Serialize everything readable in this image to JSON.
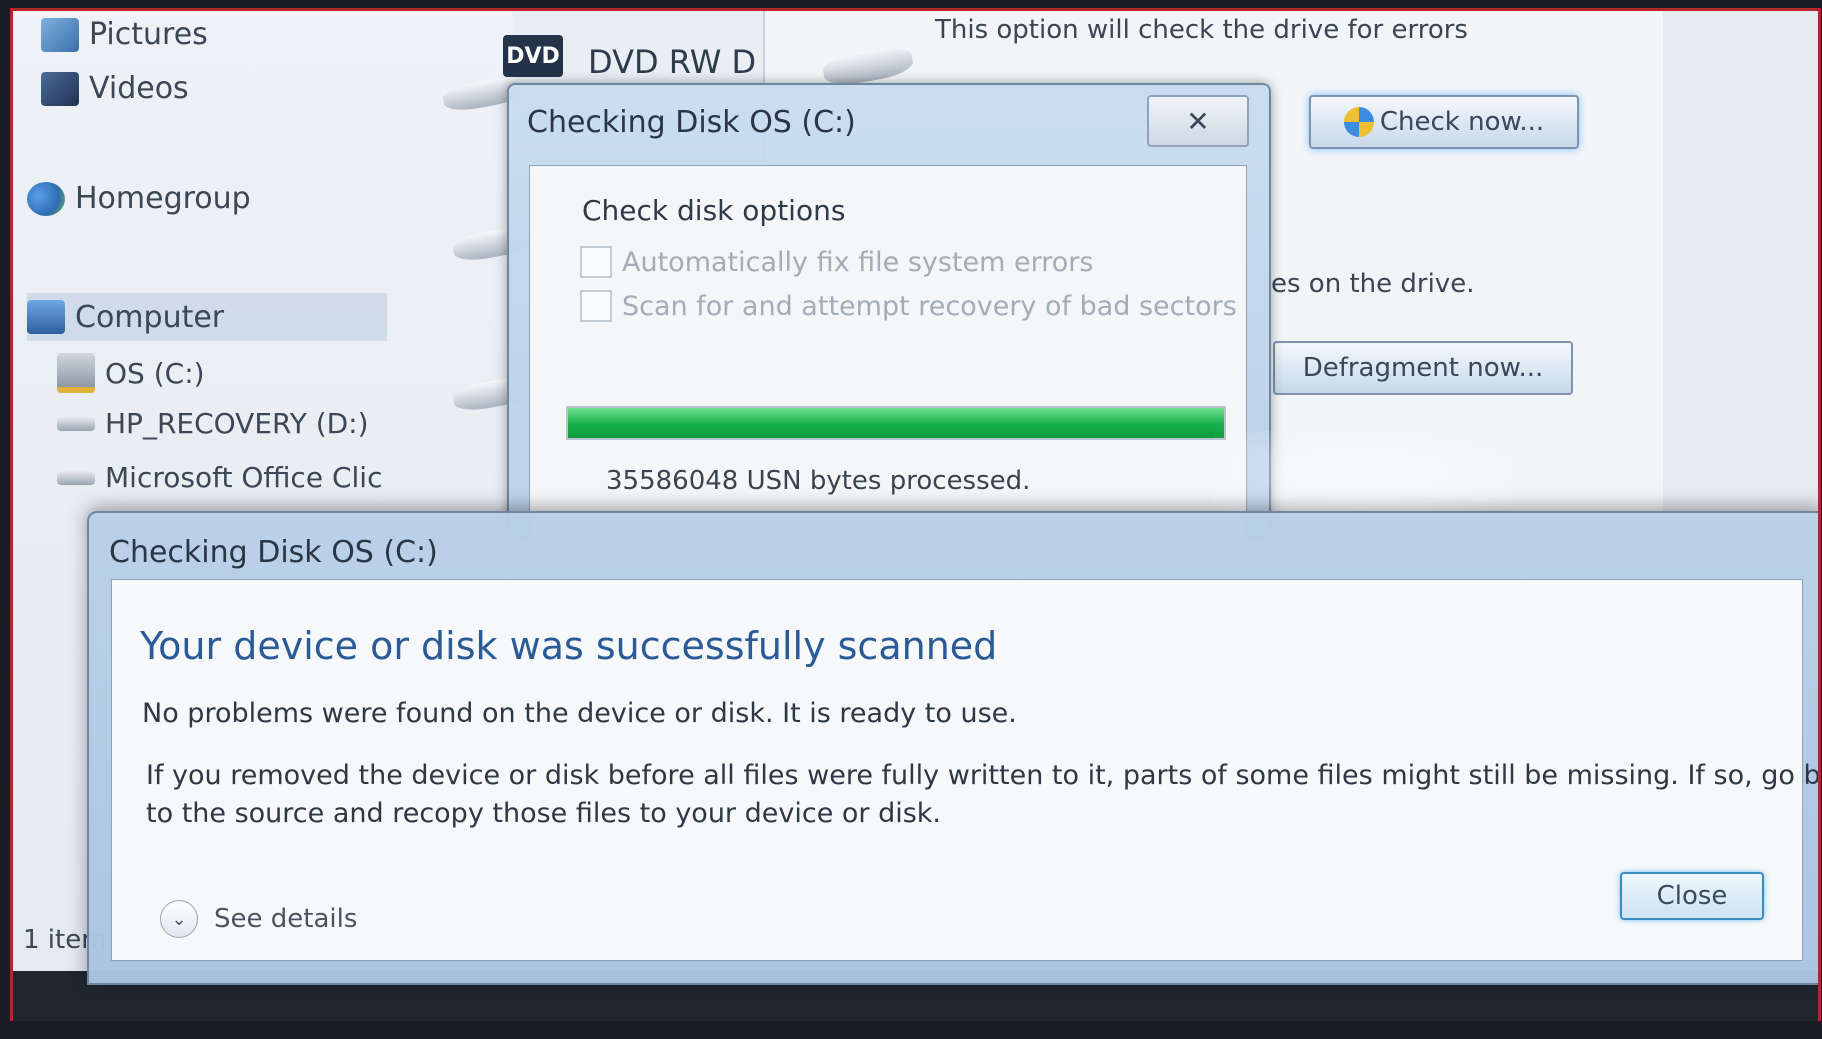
{
  "nav": {
    "items": [
      {
        "label": "Pictures",
        "icon": "pictures-icon"
      },
      {
        "label": "Videos",
        "icon": "videos-icon"
      },
      {
        "label": "Homegroup",
        "icon": "homegroup-icon"
      },
      {
        "label": "Computer",
        "icon": "computer-icon"
      },
      {
        "label": "OS (C:)",
        "icon": "hard-drive-icon"
      },
      {
        "label": "HP_RECOVERY (D:)",
        "icon": "drive-icon"
      },
      {
        "label": "Microsoft Office Clic",
        "icon": "drive-icon"
      }
    ]
  },
  "content": {
    "dvd_badge": "DVD",
    "dvd_label": "DVD RW D"
  },
  "properties": {
    "error_check_info": "This option will check the drive for errors",
    "check_now_button": "Check now...",
    "defrag_info": "es on the drive.",
    "defrag_button": "Defragment now..."
  },
  "status_bar": {
    "items_text": "1 item"
  },
  "progress_dialog": {
    "title": "Checking Disk OS (C:)",
    "close_glyph": "✕",
    "group_title": "Check disk options",
    "options": [
      {
        "label": "Automatically fix file system errors",
        "checked": false
      },
      {
        "label": "Scan for and attempt recovery of bad sectors",
        "checked": false
      }
    ],
    "progress_fraction": 1.0,
    "progress_color": "#17b04a",
    "status_text": "35586048 USN bytes processed."
  },
  "result_dialog": {
    "title": "Checking Disk OS (C:)",
    "heading": "Your device or disk was successfully scanned",
    "heading_color": "#2a5b97",
    "message1": "No problems were found on the device or disk. It is ready to use.",
    "message2_line1": "If you removed the device or disk before all files were fully written to it, parts of some files might still be missing. If so, go back",
    "message2_line2": "to the source and recopy those files to your device or disk.",
    "close_button": "Close",
    "details_toggle": "See details",
    "details_glyph": "⌄"
  }
}
